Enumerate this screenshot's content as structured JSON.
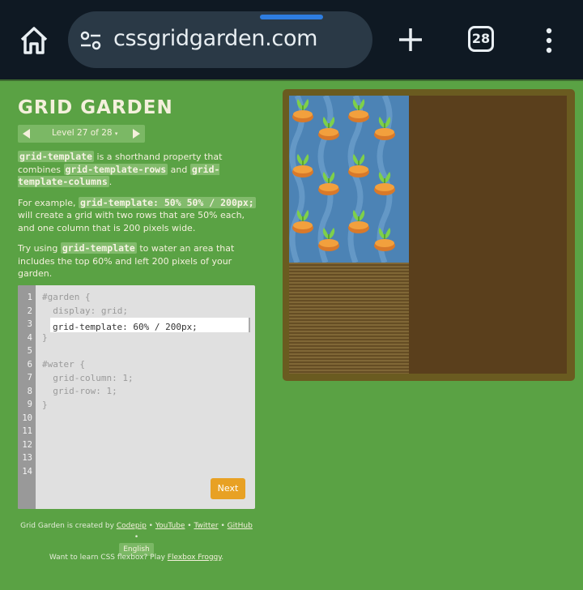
{
  "browser": {
    "url": "cssgridgarden.com",
    "tab_count": "28",
    "icons": [
      "home-icon",
      "tune-icon",
      "plus-icon",
      "tabs-icon",
      "kebab-menu-icon"
    ]
  },
  "game": {
    "title": "GRID GARDEN",
    "level_text": "Level 27 of 28",
    "level_suffix": "▾",
    "instructions": {
      "p1_code1": "grid-template",
      "p1_text1": " is a shorthand property that combines ",
      "p1_code2": "grid-template-rows",
      "p1_text2": " and ",
      "p1_code3": "grid-template-columns",
      "p1_text3": ".",
      "p2_text1": "For example, ",
      "p2_code1": "grid-template: 50% 50% / 200px;",
      "p2_text2": " will create a grid with two rows that are 50% each, and one column that is 200 pixels wide.",
      "p3_text1": "Try using ",
      "p3_code1": "grid-template",
      "p3_text2": " to water an area that includes the top 60% and left 200 pixels of your garden."
    }
  },
  "editor": {
    "line_numbers": [
      "1",
      "2",
      "3",
      "4",
      "5",
      "6",
      "7",
      "8",
      "9",
      "10",
      "11",
      "12",
      "13",
      "14"
    ],
    "lines": {
      "l1": "#garden {",
      "l2": "  display: grid;",
      "l4": "}",
      "l6": "#water {",
      "l7": "  grid-column: 1;",
      "l8": "  grid-row: 1;",
      "l9": "}"
    },
    "input_value": "grid-template: 60% / 200px;",
    "next_label": "Next"
  },
  "footer": {
    "credit_prefix": "Grid Garden is created by ",
    "codepip": "Codepip",
    "sep": " • ",
    "youtube": "YouTube",
    "twitter": "Twitter",
    "github": "GitHub",
    "language": "English",
    "froggy_prefix": "Want to learn CSS flexbox? Play ",
    "froggy_link": "Flexbox Froggy",
    "froggy_suffix": "."
  },
  "colors": {
    "background": "#5aa244",
    "water": "#4c83b5",
    "soil": "#5a3f1c",
    "next_button": "#e8a124"
  }
}
